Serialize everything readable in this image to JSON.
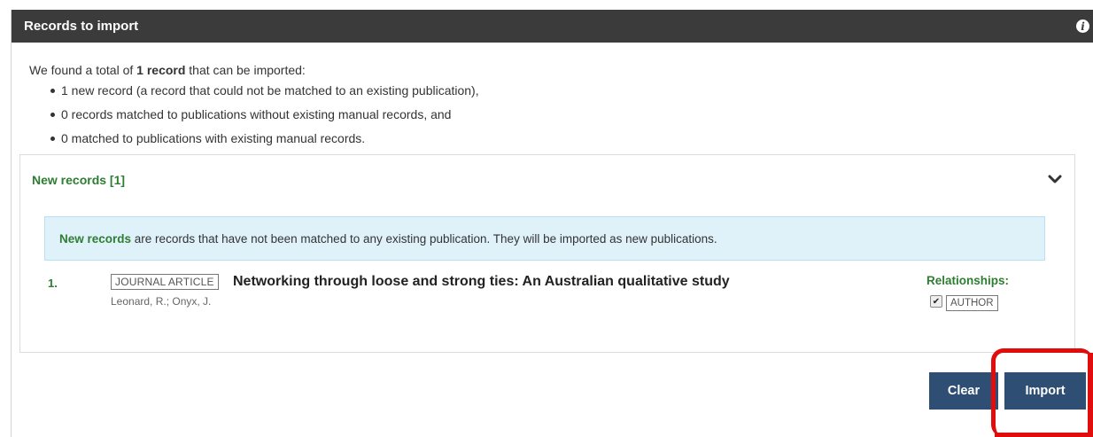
{
  "panel": {
    "title": "Records to import",
    "info_icon": "info-icon"
  },
  "summary": {
    "intro_prefix": "We found a total of ",
    "intro_bold": "1 record",
    "intro_suffix": " that can be imported:",
    "items": [
      "1 new record (a record that could not be matched to an existing publication),",
      "0 records matched to publications without existing manual records, and",
      "0 matched to publications with existing manual records."
    ]
  },
  "group": {
    "title": "New records [1]",
    "toggle_icon": "chevron-down-icon",
    "notice_bold": "New records",
    "notice_text": " are records that have not been matched to any existing publication. They will be imported as new publications.",
    "records": [
      {
        "number": "1.",
        "type": "JOURNAL ARTICLE",
        "title": "Networking through loose and strong ties: An Australian qualitative study",
        "authors": "Leonard, R.; Onyx, J.",
        "relationships_label": "Relationships:",
        "relationship": "AUTHOR",
        "relationship_checked": true
      }
    ]
  },
  "actions": {
    "clear_label": "Clear",
    "import_label": "Import"
  },
  "colors": {
    "header_bg": "#3b3b3b",
    "accent_green": "#2e7d32",
    "button_bg": "#2e4f73",
    "notice_bg": "#dff2fa",
    "highlight": "#e10c0c"
  }
}
